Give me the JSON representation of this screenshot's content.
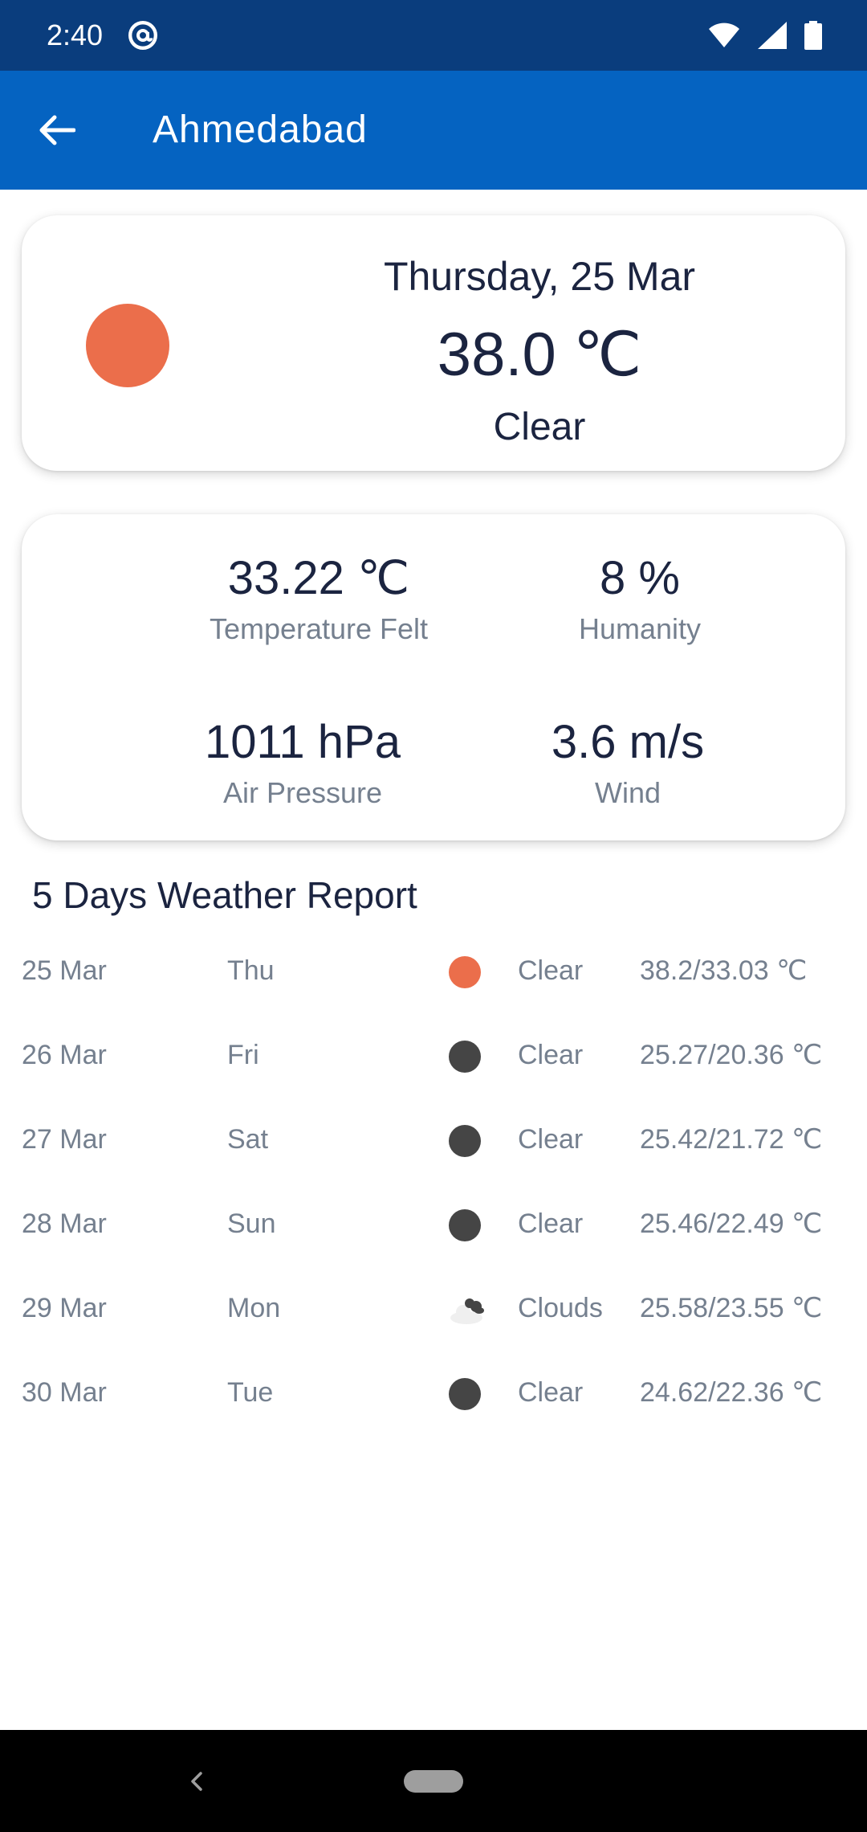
{
  "status_bar": {
    "time": "2:40",
    "icons": [
      "at-sign-icon",
      "wifi-icon",
      "cellular-signal-icon",
      "battery-icon"
    ]
  },
  "app_bar": {
    "back_icon": "arrow-left-icon",
    "title": "Ahmedabad"
  },
  "today": {
    "icon": "sun-icon",
    "icon_color": "#eb6e4b",
    "date": "Thursday, 25 Mar",
    "temperature": "38.0 ℃",
    "condition": "Clear"
  },
  "details": {
    "temperature_felt": {
      "value": "33.22 ℃",
      "label": "Temperature Felt"
    },
    "humidity": {
      "value": "8 %",
      "label": "Humanity"
    },
    "air_pressure": {
      "value": "1011 hPa",
      "label": "Air Pressure"
    },
    "wind": {
      "value": "3.6 m/s",
      "label": "Wind"
    }
  },
  "forecast": {
    "title": "5 Days Weather Report",
    "rows": [
      {
        "date": "25 Mar",
        "day": "Thu",
        "icon": "sun-icon",
        "icon_color": "#eb6e4b",
        "condition": "Clear",
        "temp": "38.2/33.03 ℃"
      },
      {
        "date": "26 Mar",
        "day": "Fri",
        "icon": "moon-icon",
        "icon_color": "#454545",
        "condition": "Clear",
        "temp": "25.27/20.36 ℃"
      },
      {
        "date": "27 Mar",
        "day": "Sat",
        "icon": "moon-icon",
        "icon_color": "#454545",
        "condition": "Clear",
        "temp": "25.42/21.72 ℃"
      },
      {
        "date": "28 Mar",
        "day": "Sun",
        "icon": "moon-icon",
        "icon_color": "#454545",
        "condition": "Clear",
        "temp": "25.46/22.49 ℃"
      },
      {
        "date": "29 Mar",
        "day": "Mon",
        "icon": "clouds-icon",
        "icon_color": "#454545",
        "condition": "Clouds",
        "temp": "25.58/23.55 ℃"
      },
      {
        "date": "30 Mar",
        "day": "Tue",
        "icon": "moon-icon",
        "icon_color": "#454545",
        "condition": "Clear",
        "temp": "24.62/22.36 ℃"
      }
    ]
  },
  "colors": {
    "status_bar": "#0a3d7d",
    "app_bar": "#0563c1",
    "primary_text": "#1b2440",
    "secondary_text": "#75808f",
    "nav_bar": "#000000"
  },
  "nav_bar": {
    "back_icon": "nav-back-icon",
    "home_icon": "nav-home-pill-icon"
  }
}
